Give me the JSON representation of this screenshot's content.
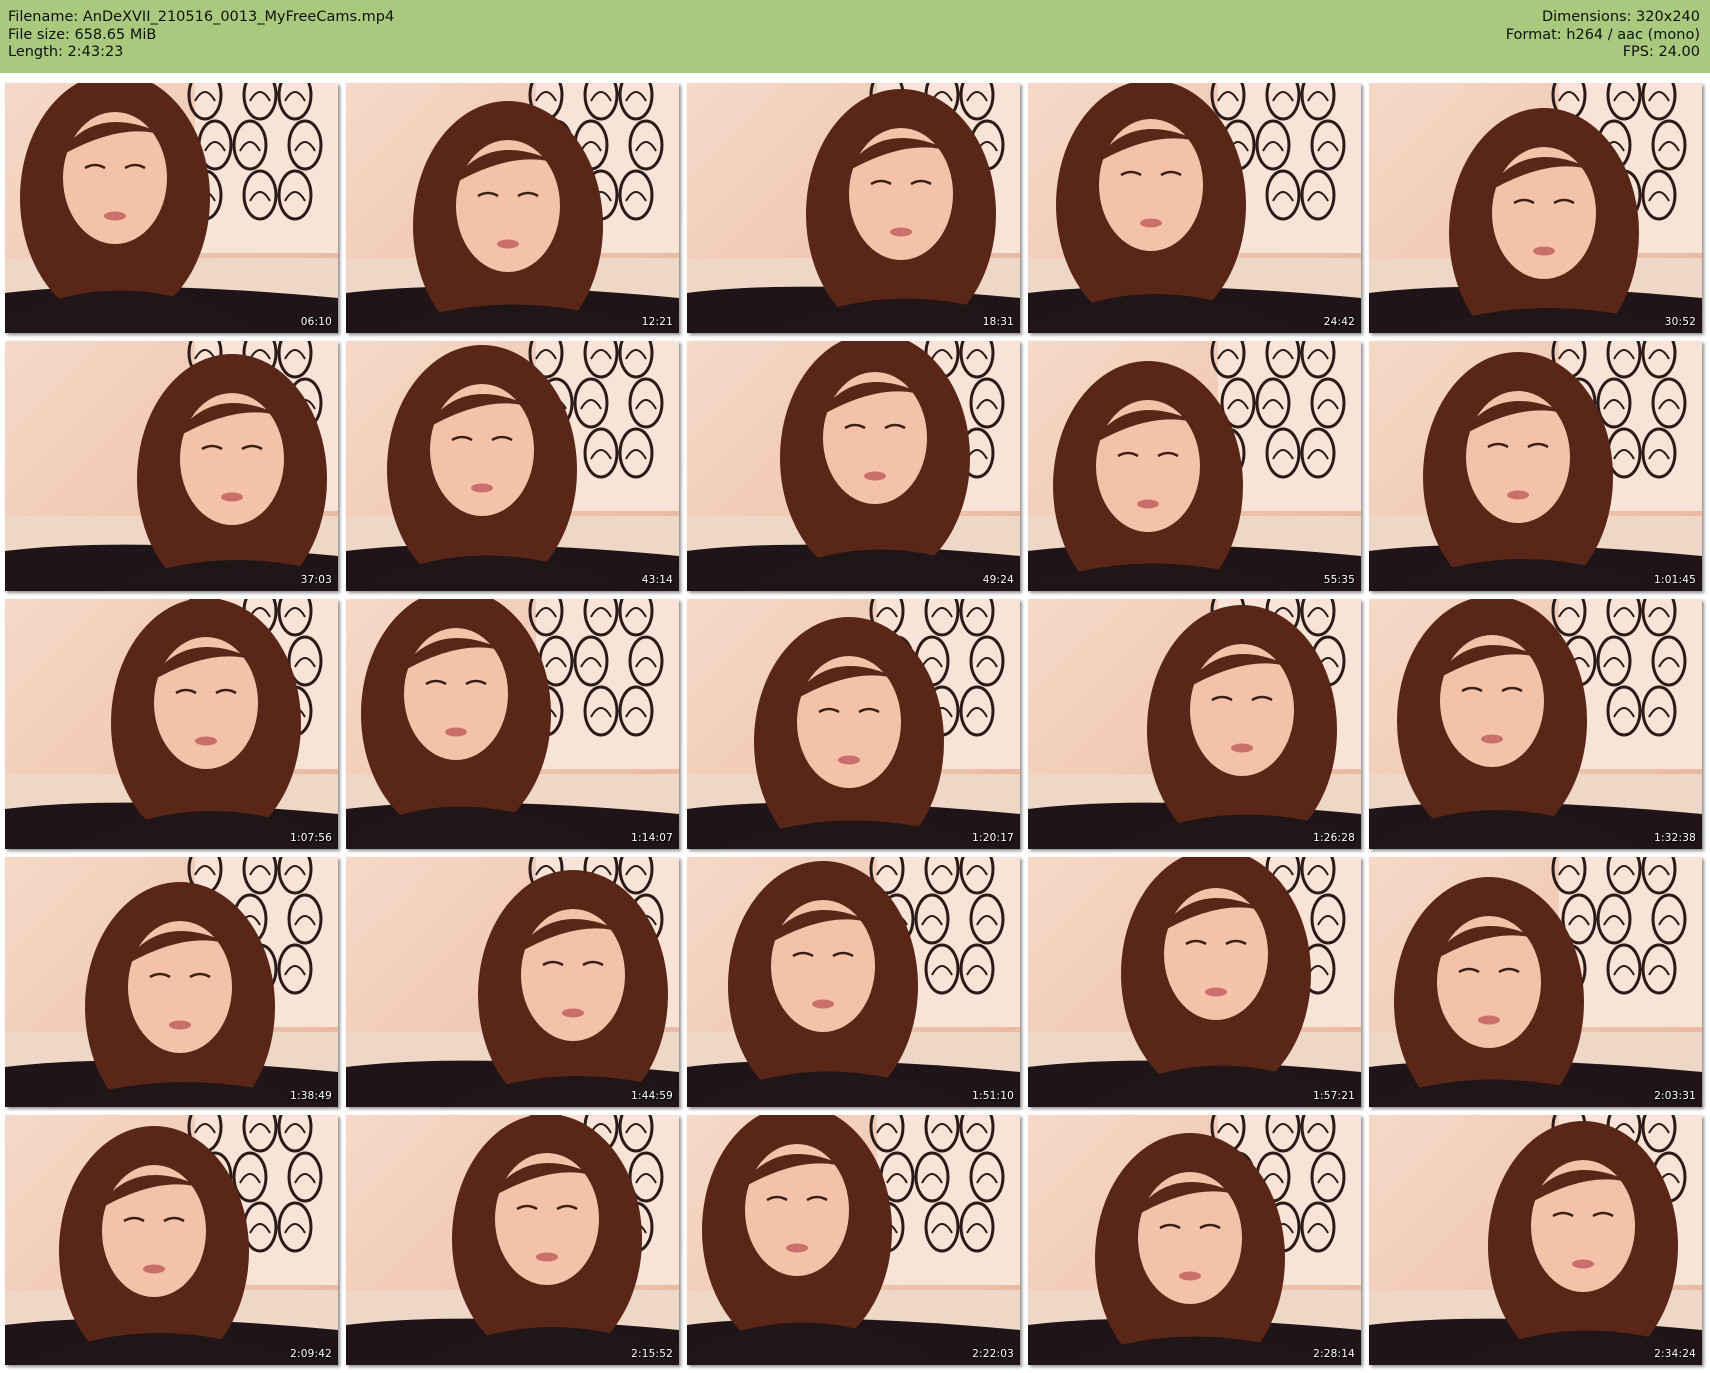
{
  "header": {
    "filename_line": "Filename: AnDeXVII_210516_0013_MyFreeCams.mp4",
    "filesize_line": "File size: 658.65 MiB",
    "length_line": "Length: 2:43:23",
    "dimensions_line": "Dimensions: 320x240",
    "format_line": "Format: h264 / aac (mono)",
    "fps_line": "FPS: 24.00",
    "background_color": "#a9c97f"
  },
  "thumbnails": [
    {
      "time": "06:10"
    },
    {
      "time": "12:21"
    },
    {
      "time": "18:31"
    },
    {
      "time": "24:42"
    },
    {
      "time": "30:52"
    },
    {
      "time": "37:03"
    },
    {
      "time": "43:14"
    },
    {
      "time": "49:24"
    },
    {
      "time": "55:35"
    },
    {
      "time": "1:01:45"
    },
    {
      "time": "1:07:56"
    },
    {
      "time": "1:14:07"
    },
    {
      "time": "1:20:17"
    },
    {
      "time": "1:26:28"
    },
    {
      "time": "1:32:38"
    },
    {
      "time": "1:38:49"
    },
    {
      "time": "1:44:59"
    },
    {
      "time": "1:51:10"
    },
    {
      "time": "1:57:21"
    },
    {
      "time": "2:03:31"
    },
    {
      "time": "2:09:42"
    },
    {
      "time": "2:15:52"
    },
    {
      "time": "2:22:03"
    },
    {
      "time": "2:28:14"
    },
    {
      "time": "2:34:24"
    }
  ]
}
